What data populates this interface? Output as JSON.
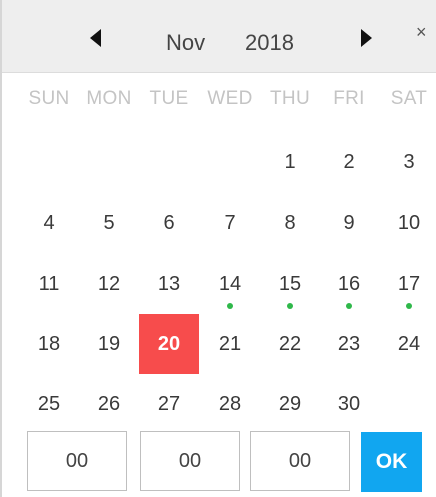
{
  "header": {
    "month": "Nov",
    "year": "2018",
    "close_label": "×"
  },
  "weekdays": [
    "SUN",
    "MON",
    "TUE",
    "WED",
    "THU",
    "FRI",
    "SAT"
  ],
  "days": [
    {
      "label": "1",
      "col": 4,
      "row": 0
    },
    {
      "label": "2",
      "col": 5,
      "row": 0
    },
    {
      "label": "3",
      "col": 6,
      "row": 0
    },
    {
      "label": "4",
      "col": 0,
      "row": 1
    },
    {
      "label": "5",
      "col": 1,
      "row": 1
    },
    {
      "label": "6",
      "col": 2,
      "row": 1
    },
    {
      "label": "7",
      "col": 3,
      "row": 1
    },
    {
      "label": "8",
      "col": 4,
      "row": 1
    },
    {
      "label": "9",
      "col": 5,
      "row": 1
    },
    {
      "label": "10",
      "col": 6,
      "row": 1
    },
    {
      "label": "11",
      "col": 0,
      "row": 2
    },
    {
      "label": "12",
      "col": 1,
      "row": 2
    },
    {
      "label": "13",
      "col": 2,
      "row": 2
    },
    {
      "label": "14",
      "col": 3,
      "row": 2,
      "marked": true
    },
    {
      "label": "15",
      "col": 4,
      "row": 2,
      "marked": true
    },
    {
      "label": "16",
      "col": 5,
      "row": 2,
      "marked": true
    },
    {
      "label": "17",
      "col": 6,
      "row": 2,
      "marked": true
    },
    {
      "label": "18",
      "col": 0,
      "row": 3
    },
    {
      "label": "19",
      "col": 1,
      "row": 3
    },
    {
      "label": "20",
      "col": 2,
      "row": 3,
      "selected": true
    },
    {
      "label": "21",
      "col": 3,
      "row": 3
    },
    {
      "label": "22",
      "col": 4,
      "row": 3
    },
    {
      "label": "23",
      "col": 5,
      "row": 3
    },
    {
      "label": "24",
      "col": 6,
      "row": 3
    },
    {
      "label": "25",
      "col": 0,
      "row": 4
    },
    {
      "label": "26",
      "col": 1,
      "row": 4
    },
    {
      "label": "27",
      "col": 2,
      "row": 4
    },
    {
      "label": "28",
      "col": 3,
      "row": 4
    },
    {
      "label": "29",
      "col": 4,
      "row": 4
    },
    {
      "label": "30",
      "col": 5,
      "row": 4
    }
  ],
  "time": {
    "hours": "00",
    "minutes": "00",
    "seconds": "00"
  },
  "ok_label": "OK",
  "colors": {
    "selected_bg": "#f74c4c",
    "marker_dot": "#2fb84a",
    "ok_bg": "#11a6f0",
    "weekday_text": "#c4c4c4"
  }
}
